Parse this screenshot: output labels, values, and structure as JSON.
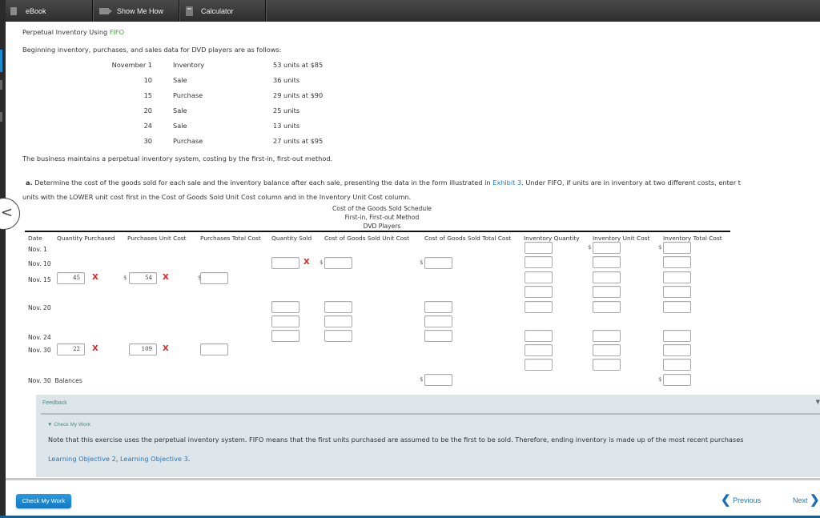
{
  "toolbar": {
    "ebook": "eBook",
    "show_me_how": "Show Me How",
    "calculator": "Calculator"
  },
  "page": {
    "title_prefix": "Perpetual Inventory Using ",
    "title_highlight": "FIFO",
    "intro": "Beginning inventory, purchases, and sales data for DVD players are as follows:",
    "transactions": [
      {
        "date": "November 1",
        "event": "Inventory",
        "detail": "53 units at $85"
      },
      {
        "date": "10",
        "event": "Sale",
        "detail": "36 units"
      },
      {
        "date": "15",
        "event": "Purchase",
        "detail": "29 units at $90"
      },
      {
        "date": "20",
        "event": "Sale",
        "detail": "25 units"
      },
      {
        "date": "24",
        "event": "Sale",
        "detail": "13 units"
      },
      {
        "date": "30",
        "event": "Purchase",
        "detail": "27 units at $95"
      }
    ],
    "method_note": "The business maintains a perpetual inventory system, costing by the first-in, first-out method.",
    "instruction_label": "a.",
    "instruction_part1": " Determine the cost of the goods sold for each sale and the inventory balance after each sale, presenting the data in the form illustrated in ",
    "instruction_link": "Exhibit 3",
    "instruction_part2": ". Under FIFO, if units are in inventory at two different costs, enter t",
    "instruction_line2": "units with the LOWER unit cost first in the Cost of Goods Sold Unit Cost column and in the Inventory Unit Cost column."
  },
  "schedule": {
    "title_lines": [
      "Cost of the Goods Sold Schedule",
      "First-in, First-out Method",
      "DVD Players"
    ],
    "headers": [
      "Date",
      "Quantity Purchased",
      "Purchases Unit Cost",
      "Purchases Total Cost",
      "Quantity Sold",
      "Cost of Goods Sold Unit Cost",
      "Cost of Goods Sold Total Cost",
      "Inventory Quantity",
      "Inventory Unit Cost",
      "Inventory Total Cost"
    ],
    "row_labels": [
      "Nov. 1",
      "Nov. 10",
      "Nov. 15",
      "Nov. 20",
      "Nov. 24",
      "Nov. 30",
      "Nov. 30  Balances"
    ],
    "entries": {
      "nov15_qty_purchased": "45",
      "nov15_purchase_unit_cost": "54",
      "nov30_qty_purchased": "22",
      "nov30_purchase_unit_cost": "109"
    },
    "currency_symbol": "$",
    "incorrect_mark": "X"
  },
  "feedback": {
    "heading": "Feedback",
    "check_label": "Check My Work",
    "note": "Note that this exercise uses the perpetual inventory system. FIFO means that the first units purchased are assumed to be the first to be sold. Therefore, ending inventory is made up of the most recent purchases",
    "lo1": "Learning Objective 2",
    "lo_sep": ", ",
    "lo2": "Learning Objective 3",
    "lo_end": "."
  },
  "footer": {
    "check_button": "Check My Work",
    "previous": "Previous",
    "next": "Next"
  },
  "colors": {
    "accent_blue": "#1a7ac8",
    "fifo_green": "#3aa63a",
    "error_red": "#e61e1e",
    "feedback_bg": "#dde5e8"
  }
}
